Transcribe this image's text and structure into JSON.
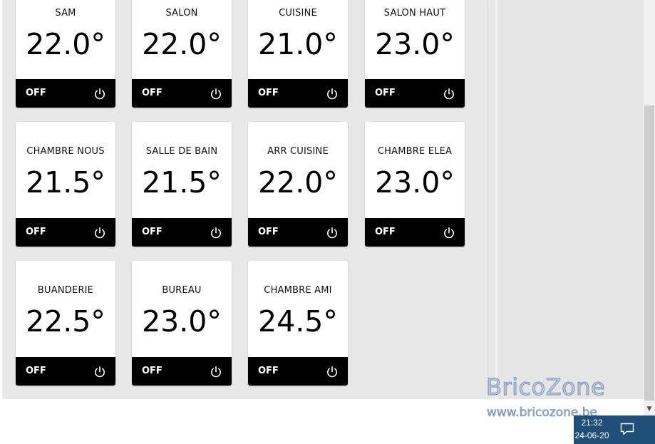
{
  "rooms": [
    {
      "name": "SAM",
      "temp": "22.0°",
      "status": "OFF"
    },
    {
      "name": "SALON",
      "temp": "22.0°",
      "status": "OFF"
    },
    {
      "name": "CUISINE",
      "temp": "21.0°",
      "status": "OFF"
    },
    {
      "name": "SALON HAUT",
      "temp": "23.0°",
      "status": "OFF"
    },
    {
      "name": "CHAMBRE NOUS",
      "temp": "21.5°",
      "status": "OFF"
    },
    {
      "name": "SALLE DE BAIN",
      "temp": "21.5°",
      "status": "OFF"
    },
    {
      "name": "ARR CUISINE",
      "temp": "22.0°",
      "status": "OFF"
    },
    {
      "name": "CHAMBRE ELEA",
      "temp": "23.0°",
      "status": "OFF"
    },
    {
      "name": "BUANDERIE",
      "temp": "22.5°",
      "status": "OFF"
    },
    {
      "name": "BUREAU",
      "temp": "23.0°",
      "status": "OFF"
    },
    {
      "name": "CHAMBRE AMI",
      "temp": "24.5°",
      "status": "OFF"
    }
  ],
  "icons": {
    "power": "power-icon",
    "notification": "notification-icon",
    "scroll_down": "scroll-down-arrow-icon"
  },
  "watermark": {
    "title": "BricoZone",
    "url": "www.bricozone.be"
  },
  "taskbar": {
    "time": "21:32",
    "date": "24-06-20"
  },
  "colors": {
    "panel_background": "#e8e8e8",
    "tile_background": "#ffffff",
    "tile_bar": "#000000",
    "taskbar": "#1f4e79"
  }
}
